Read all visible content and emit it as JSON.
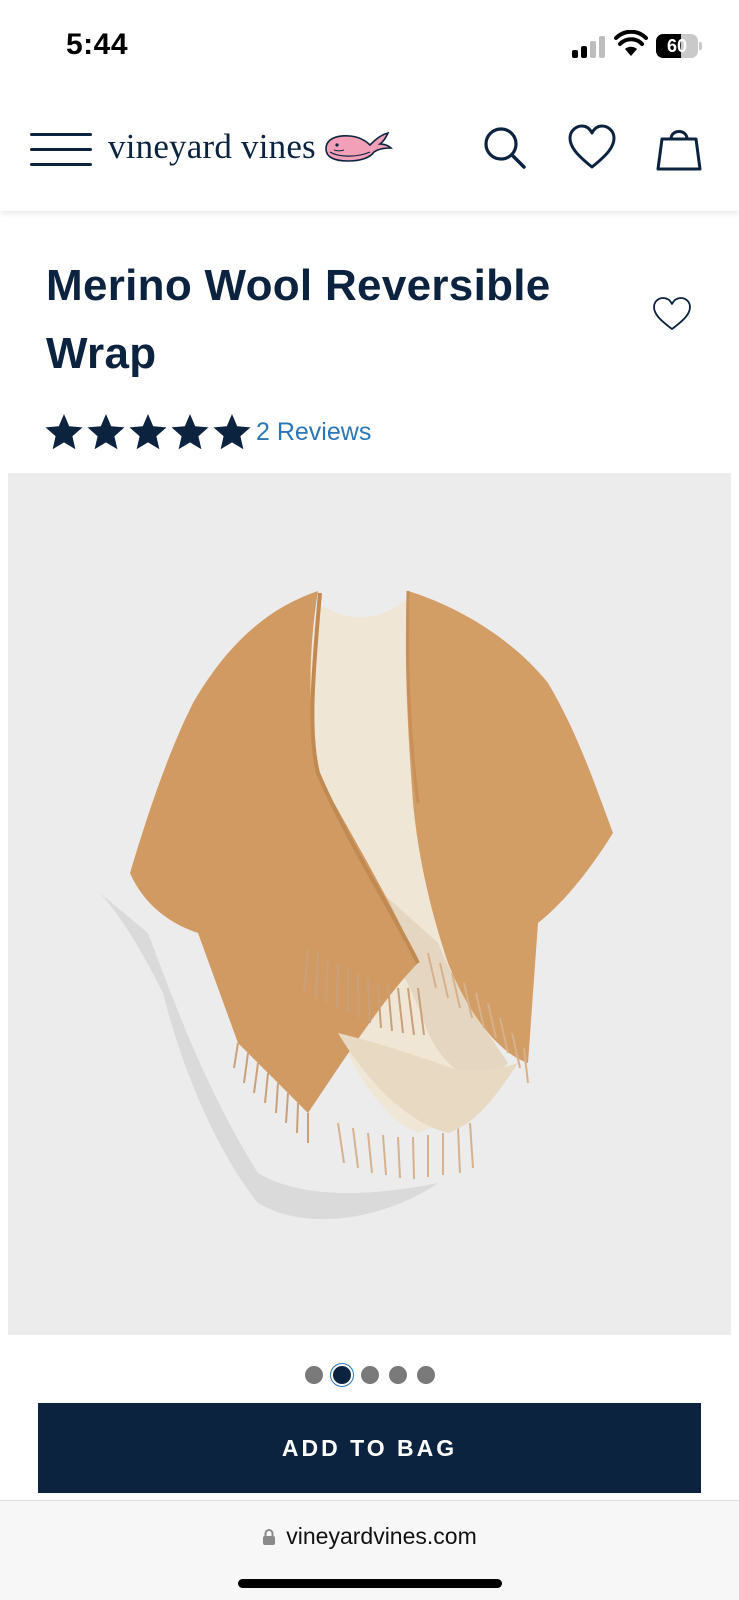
{
  "status_bar": {
    "time": "5:44",
    "battery": "60",
    "battery_level": 0.6,
    "signal_bars": 2,
    "signal_icon": "cellular-signal-icon",
    "wifi_icon": "wifi-icon"
  },
  "header": {
    "menu_icon": "hamburger-menu-icon",
    "logo_text": "vineyard vines",
    "logo_icon": "whale-logo-icon",
    "search_icon": "search-icon",
    "wishlist_icon": "heart-icon",
    "bag_icon": "shopping-bag-icon"
  },
  "product": {
    "title": "Merino Wool Reversible Wrap",
    "favorite_icon": "heart-outline-icon",
    "rating": 5,
    "rating_max": 5,
    "reviews_label": "2 Reviews",
    "image_count": 5,
    "active_image": 2
  },
  "actions": {
    "add_to_bag": "ADD TO BAG"
  },
  "browser": {
    "url": "vineyardvines.com",
    "lock_icon": "lock-icon"
  },
  "colors": {
    "brand_navy": "#0c2340",
    "link_blue": "#2b77b5",
    "whale_pink": "#f2a0b8",
    "image_bg": "#ececec",
    "camel": "#d09a62"
  }
}
